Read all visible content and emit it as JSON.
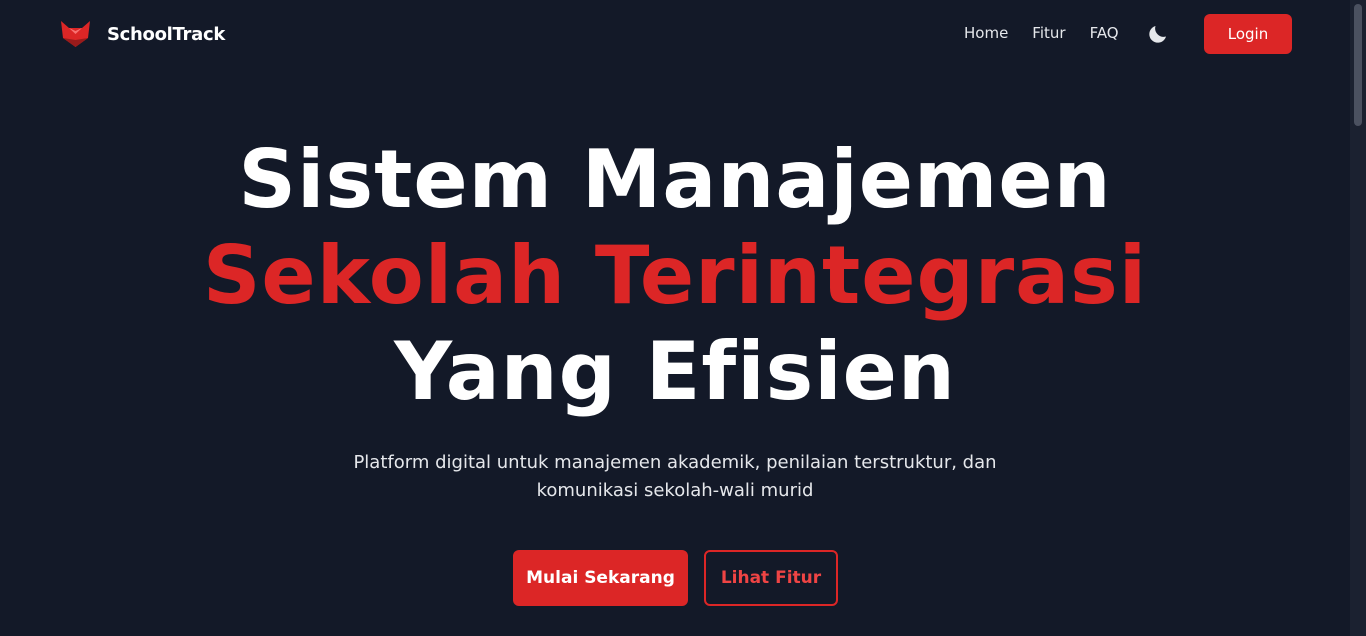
{
  "brand": {
    "name": "SchoolTrack",
    "logo_icon": "fox-logo-icon",
    "accent_color": "#dc2626"
  },
  "nav": {
    "links": [
      "Home",
      "Fitur",
      "FAQ"
    ],
    "theme_toggle_icon": "moon-icon",
    "login_label": "Login"
  },
  "hero": {
    "title_line_1": "Sistem Manajemen",
    "title_line_2": "Sekolah Terintegrasi",
    "title_line_3": "Yang Efisien",
    "subtitle": "Platform digital untuk manajemen akademik, penilaian terstruktur, dan komunikasi sekolah-wali murid",
    "primary_cta": "Mulai Sekarang",
    "secondary_cta": "Lihat Fitur"
  },
  "colors": {
    "background": "#131928",
    "accent": "#dc2626",
    "text": "#ffffff"
  }
}
